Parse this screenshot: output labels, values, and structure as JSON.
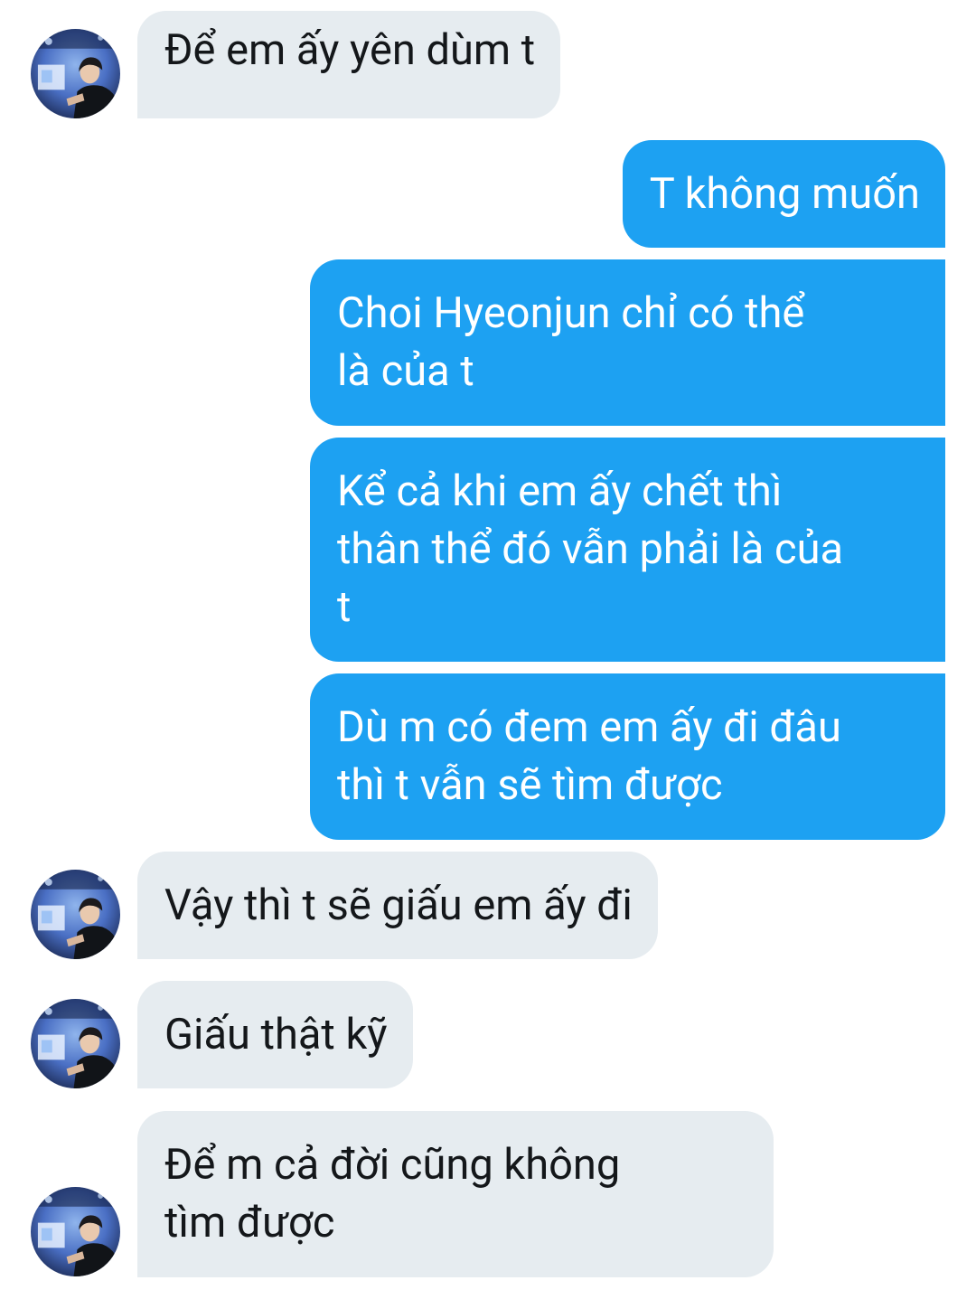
{
  "conversation": {
    "messages": [
      {
        "sender": "other",
        "text": "Để em ấy yên dùm t"
      },
      {
        "sender": "self",
        "text": "T không muốn"
      },
      {
        "sender": "self",
        "lines": [
          "Choi Hyeonjun chỉ có thể",
          "là của t"
        ]
      },
      {
        "sender": "self",
        "lines": [
          "Kể cả khi em ấy chết thì",
          "thân thể đó vẫn phải là của",
          "t"
        ]
      },
      {
        "sender": "self",
        "lines": [
          "Dù m có đem em ấy đi đâu",
          "thì t vẫn sẽ tìm được"
        ]
      },
      {
        "sender": "other",
        "text": "Vậy thì t sẽ giấu em ấy đi"
      },
      {
        "sender": "other",
        "text": "Giấu thật kỹ"
      },
      {
        "sender": "other",
        "lines": [
          "Để m cả đời cũng không",
          "tìm được"
        ]
      }
    ]
  },
  "colors": {
    "incoming_bubble": "#e6ecf0",
    "incoming_text": "#14171a",
    "outgoing_bubble": "#1da1f2",
    "outgoing_text": "#ffffff",
    "background": "#ffffff"
  },
  "icons": {
    "avatar": "profile-photo-avatar"
  }
}
